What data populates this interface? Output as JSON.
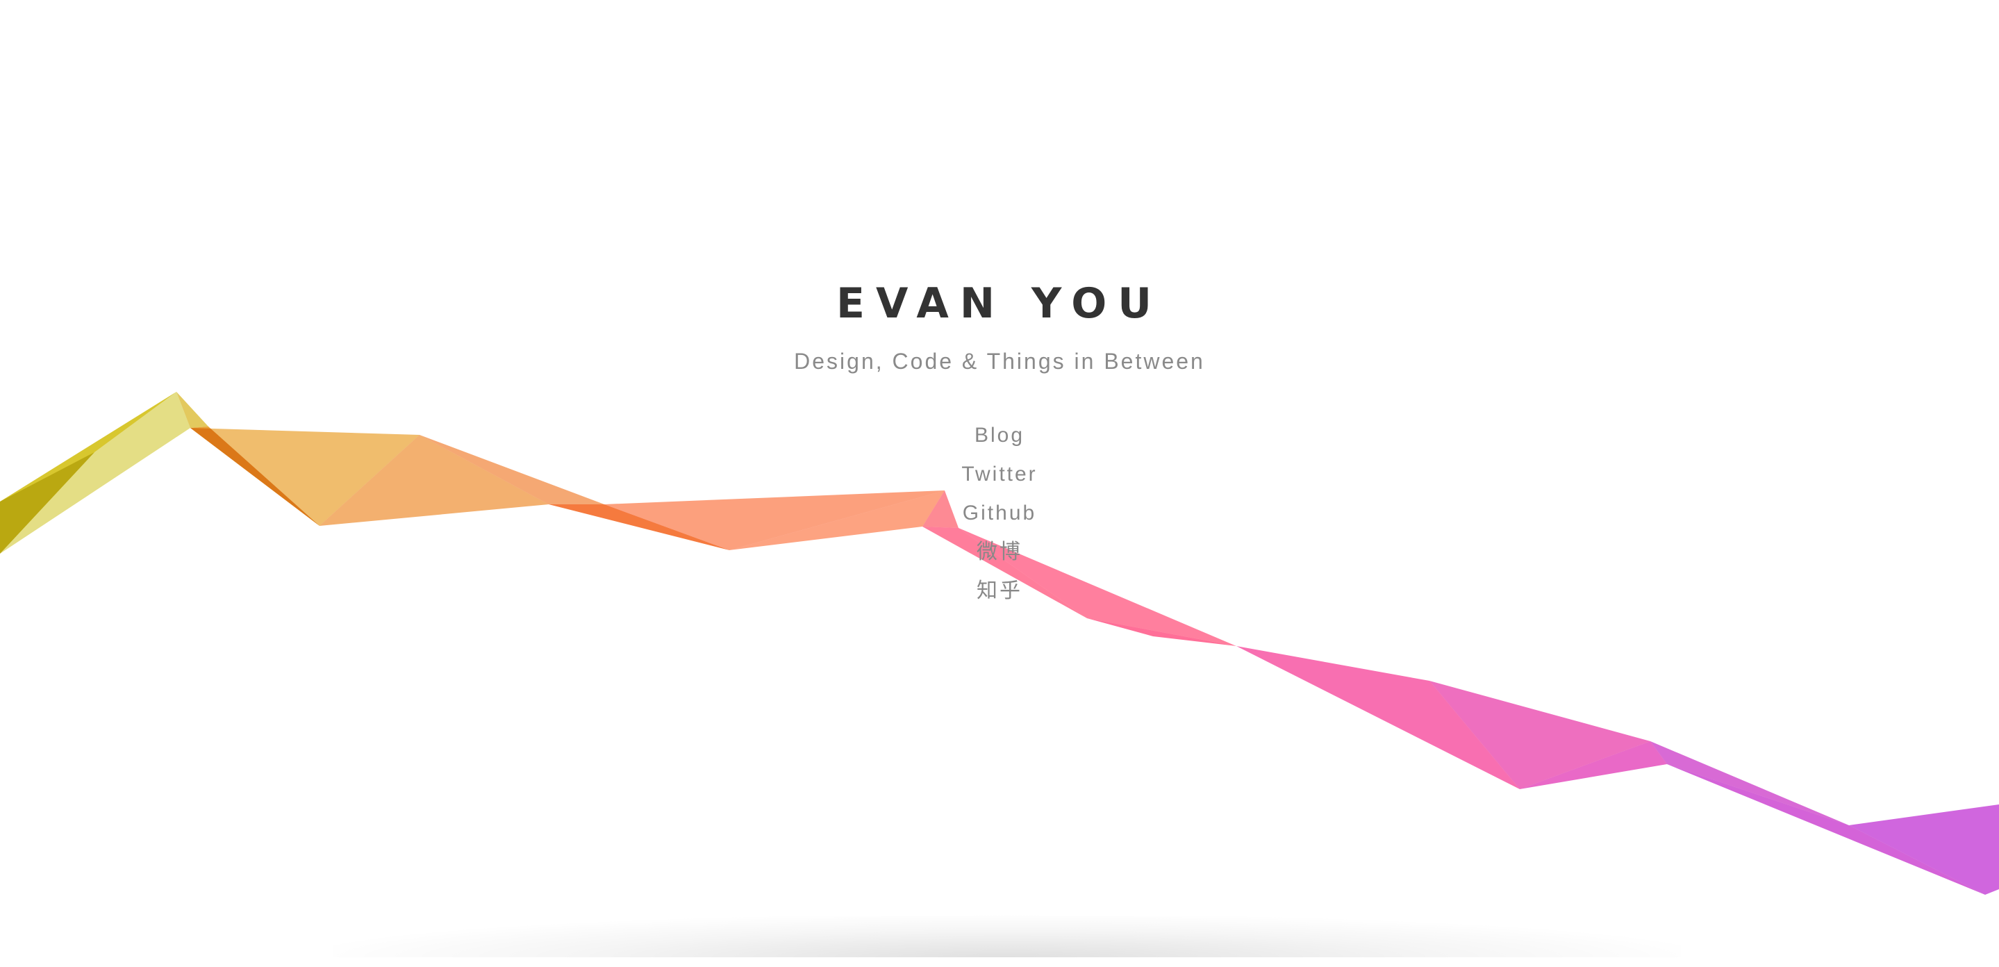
{
  "header": {
    "title": "EVAN YOU",
    "tagline": "Design, Code & Things in Between"
  },
  "nav": {
    "links": [
      {
        "label": "Blog"
      },
      {
        "label": "Twitter"
      },
      {
        "label": "Github"
      },
      {
        "label": "微博"
      },
      {
        "label": "知乎"
      }
    ]
  },
  "colors": {
    "title": "#333333",
    "text_muted": "#888888",
    "ribbon_start": "#d6c93a",
    "ribbon_mid_orange": "#f5a870",
    "ribbon_mid_pink": "#ff7aa0",
    "ribbon_end": "#d066de"
  }
}
